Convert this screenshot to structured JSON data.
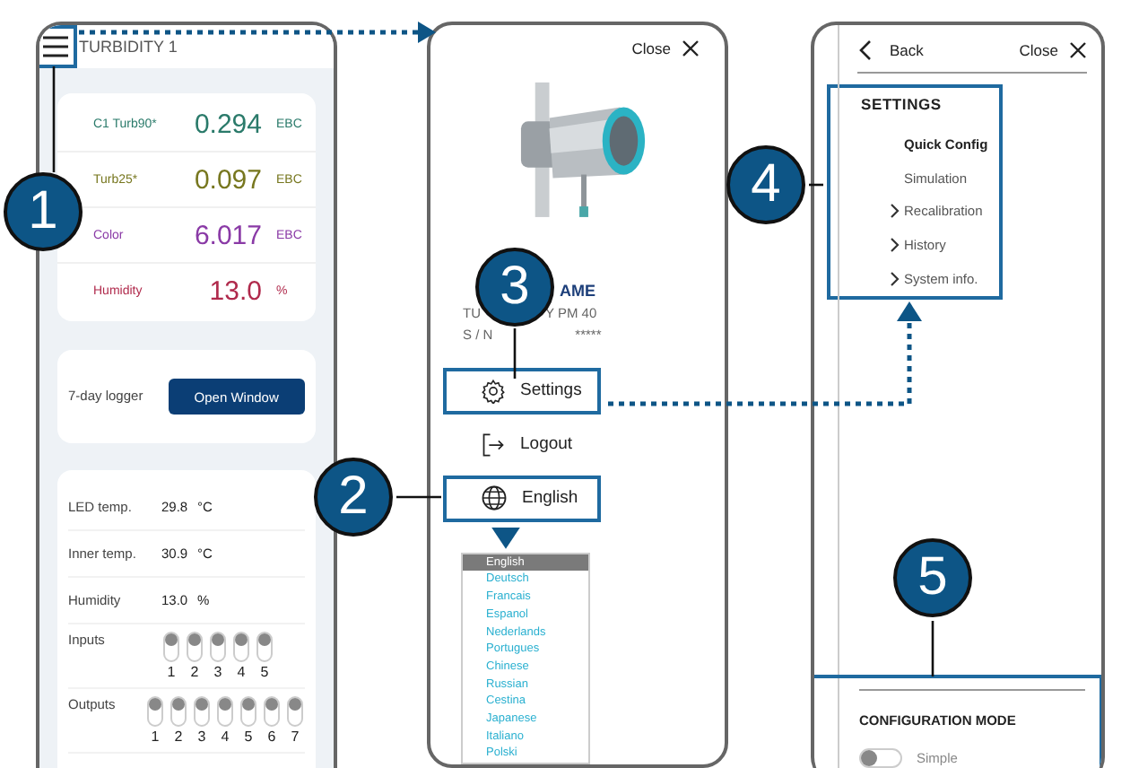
{
  "header": {
    "title": "TURBIDITY 1"
  },
  "measurements": [
    {
      "label": "C1 Turb90*",
      "value": "0.294",
      "unit": "EBC",
      "color": "#2a7a6a"
    },
    {
      "label": "Turb25*",
      "value": "0.097",
      "unit": "EBC",
      "color": "#77771f"
    },
    {
      "label": "Color",
      "value": "6.017",
      "unit": "EBC",
      "color": "#8a3aa6"
    },
    {
      "label": "Humidity",
      "value": "13.0",
      "unit": "%",
      "color": "#b02a4c"
    }
  ],
  "logger": {
    "label": "7-day logger",
    "button": "Open Window"
  },
  "diagnostics": [
    {
      "label": "LED temp.",
      "value": "29.8",
      "unit": "°C"
    },
    {
      "label": "Inner temp.",
      "value": "30.9",
      "unit": "°C"
    },
    {
      "label": "Humidity",
      "value": "13.0",
      "unit": "%"
    }
  ],
  "inputs": {
    "label": "Inputs",
    "channels": [
      {
        "number": "1",
        "on": false
      },
      {
        "number": "2",
        "on": false
      },
      {
        "number": "3",
        "on": false
      },
      {
        "number": "4",
        "on": false
      },
      {
        "number": "5",
        "on": false
      }
    ]
  },
  "outputs": {
    "label": "Outputs",
    "channels": [
      {
        "number": "1",
        "on": false
      },
      {
        "number": "2",
        "on": false
      },
      {
        "number": "3",
        "on": false
      },
      {
        "number": "4",
        "on": false
      },
      {
        "number": "5",
        "on": false
      },
      {
        "number": "6",
        "on": false
      },
      {
        "number": "7",
        "on": false
      }
    ]
  },
  "device_menu": {
    "close": "Close",
    "name": "AME",
    "model_start": "TU",
    "model_end": "Y PM 40",
    "serial_label": "S / N",
    "serial": "*****",
    "items": [
      {
        "kind": "settings",
        "label": "Settings",
        "highlighted": true
      },
      {
        "kind": "logout",
        "label": "Logout",
        "highlighted": false
      },
      {
        "kind": "language",
        "label": "English",
        "highlighted": true
      }
    ],
    "languages": [
      {
        "label": "English",
        "selected": true
      },
      {
        "label": "Deutsch",
        "selected": false
      },
      {
        "label": "Francais",
        "selected": false
      },
      {
        "label": "Espanol",
        "selected": false
      },
      {
        "label": "Nederlands",
        "selected": false
      },
      {
        "label": "Portugues",
        "selected": false
      },
      {
        "label": "Chinese",
        "selected": false
      },
      {
        "label": "Russian",
        "selected": false
      },
      {
        "label": "Cestina",
        "selected": false
      },
      {
        "label": "Japanese",
        "selected": false
      },
      {
        "label": "Italiano",
        "selected": false
      },
      {
        "label": "Polski",
        "selected": false
      }
    ]
  },
  "settings": {
    "back": "Back",
    "close": "Close",
    "title": "SETTINGS",
    "items": [
      {
        "label": "Quick Config",
        "selected": true,
        "expandable": false
      },
      {
        "label": "Simulation",
        "selected": false,
        "expandable": false
      },
      {
        "label": "Recalibration",
        "selected": false,
        "expandable": true
      },
      {
        "label": "History",
        "selected": false,
        "expandable": true
      },
      {
        "label": "System info.",
        "selected": false,
        "expandable": true
      }
    ],
    "config_mode": {
      "title": "CONFIGURATION MODE",
      "label": "Simple",
      "on": false
    }
  },
  "callouts": [
    "1",
    "2",
    "3",
    "4",
    "5"
  ]
}
